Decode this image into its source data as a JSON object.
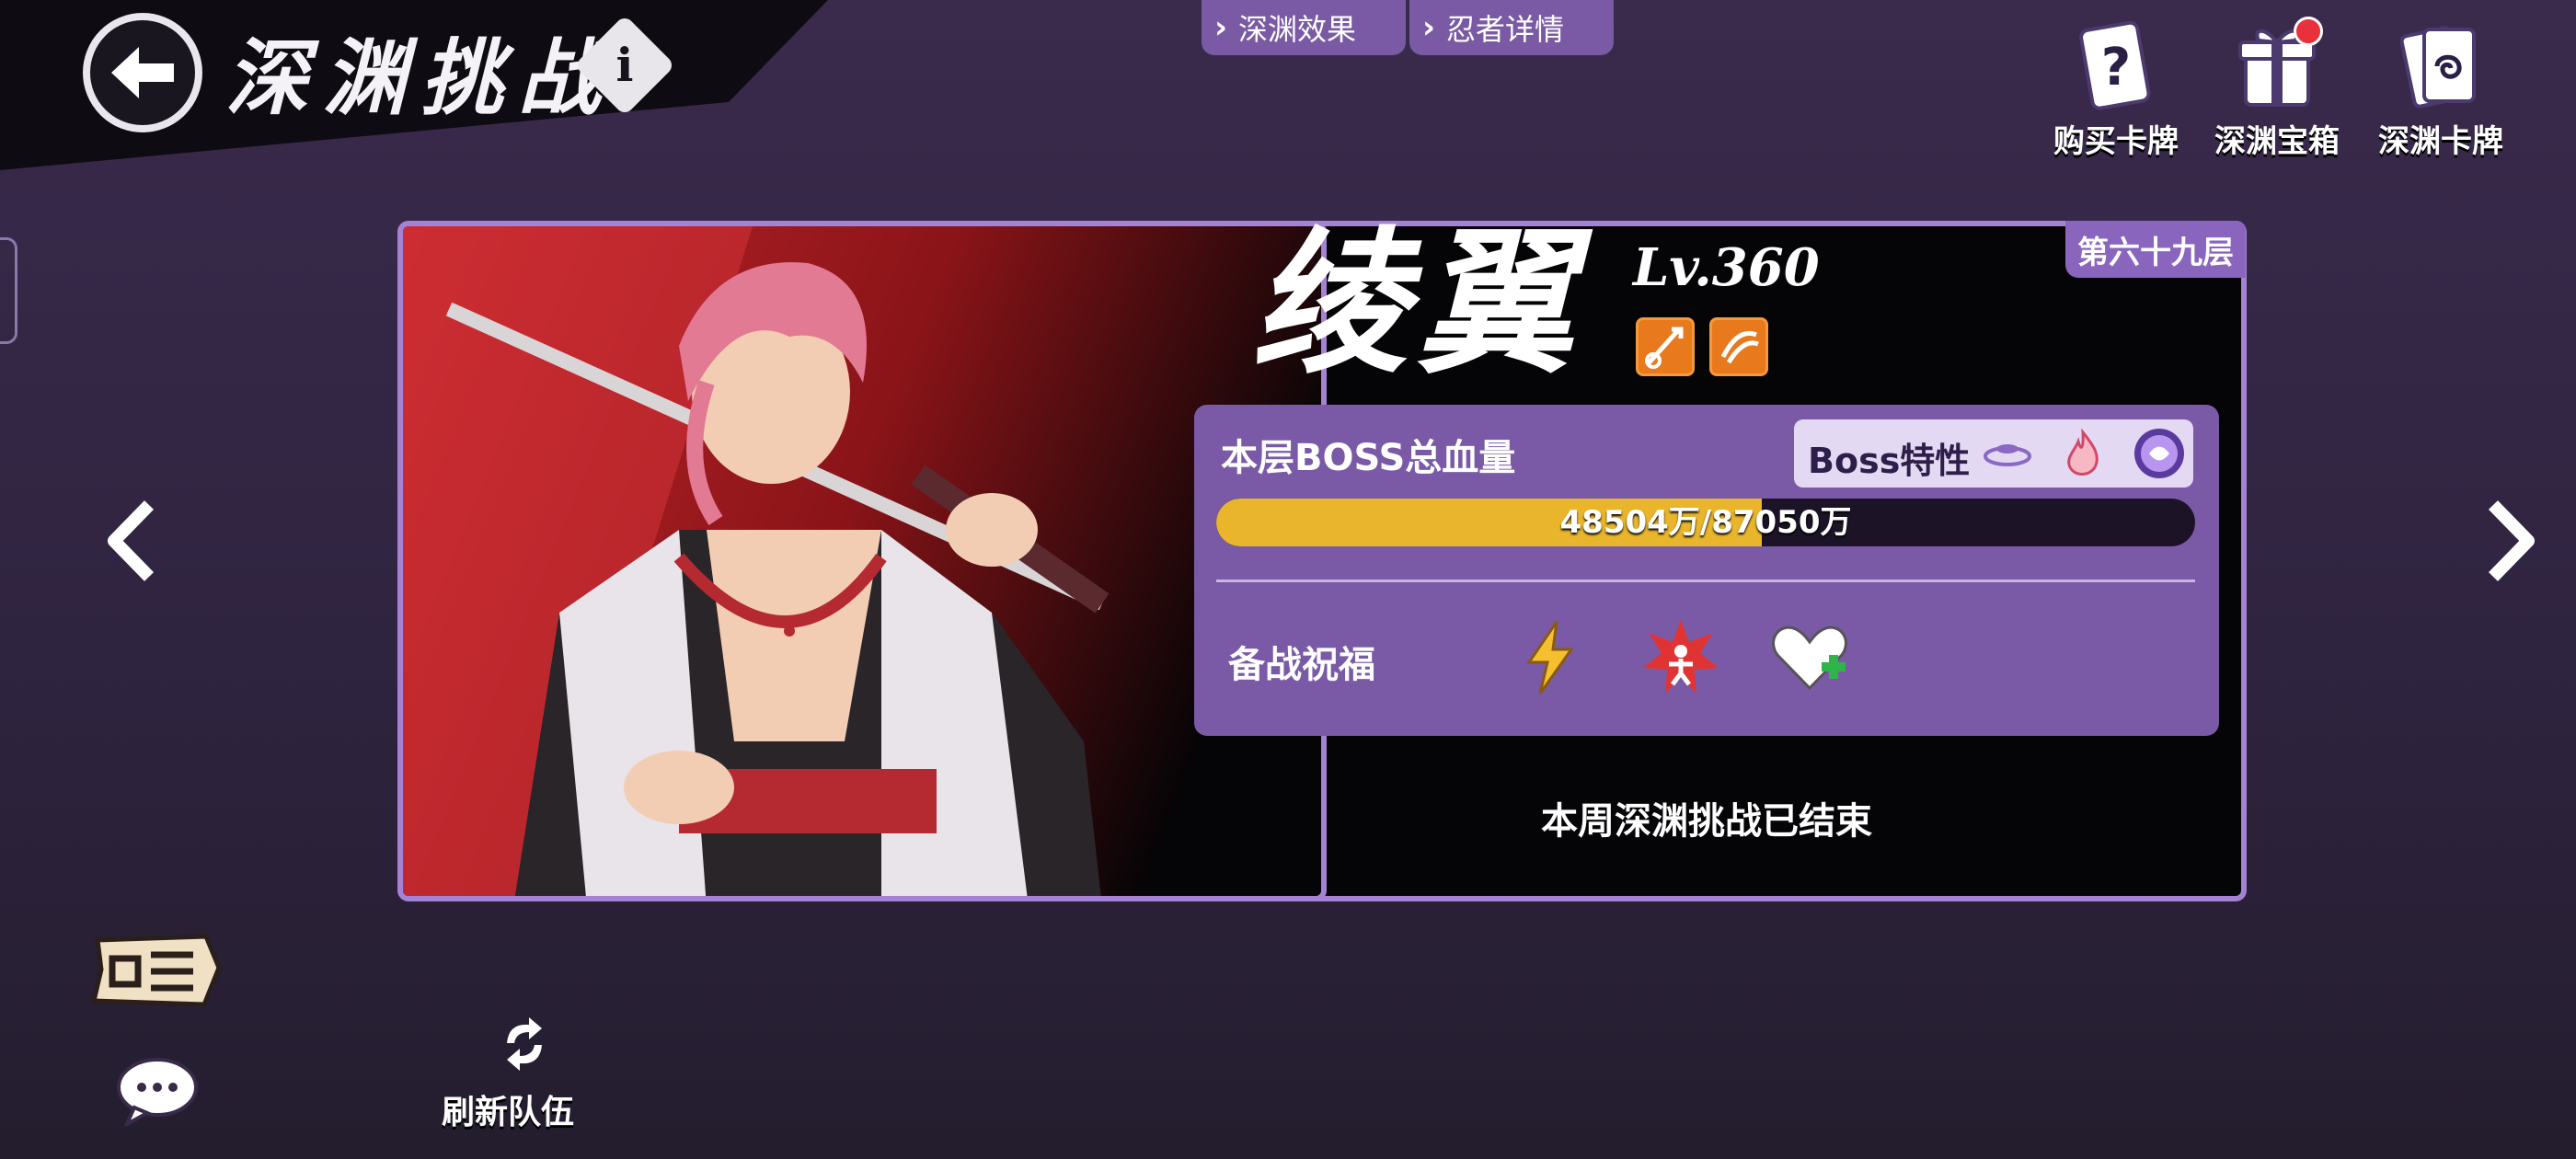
{
  "header": {
    "title": "深渊挑战",
    "info": "i"
  },
  "tabs": [
    {
      "label": "深渊效果"
    },
    {
      "label": "忍者详情"
    }
  ],
  "actions": [
    {
      "label": "购买卡牌",
      "icon": "card-question-icon"
    },
    {
      "label": "深渊宝箱",
      "icon": "gift-box-icon",
      "notification": true
    },
    {
      "label": "深渊卡牌",
      "icon": "card-stack-icon"
    }
  ],
  "boss": {
    "floor": "第六十九层",
    "name": "绫翼",
    "level": "Lv.360",
    "skill_icons": [
      "sword-speed-icon",
      "swirl-icon"
    ],
    "hp_label": "本层BOSS总血量",
    "hp_text": "48504万/87050万",
    "hp_current": 48504,
    "hp_max": 87050,
    "traits_label": "Boss特性",
    "trait_icons": [
      "swirl-wave-icon",
      "flame-icon",
      "purple-orb-icon"
    ],
    "blessing_label": "备战祝福",
    "blessing_icons": [
      "lightning-icon",
      "burst-figure-icon",
      "heart-plus-icon"
    ],
    "status_text": "本周深渊挑战已结束"
  },
  "bottom": {
    "refresh_label": "刷新队伍"
  },
  "colors": {
    "accent_purple": "#7a5aa6",
    "border_purple": "#a483d4",
    "hp_yellow": "#e9b52c",
    "skill_orange": "#e8791d"
  }
}
